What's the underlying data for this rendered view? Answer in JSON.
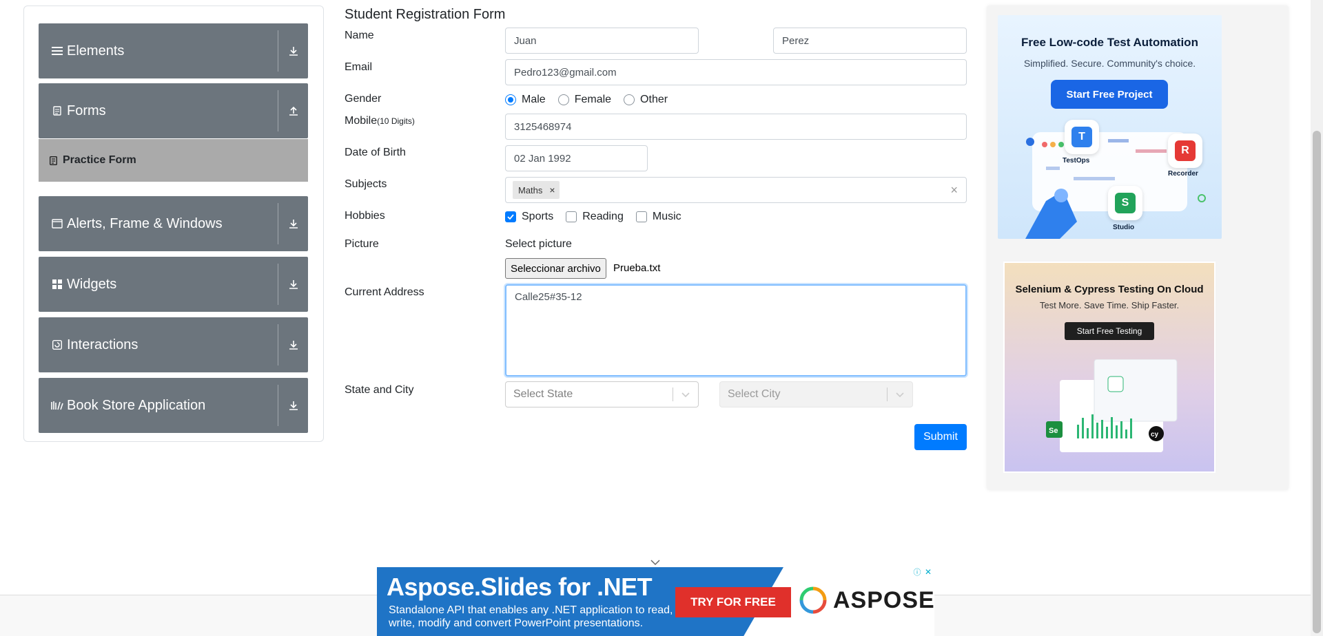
{
  "sidebar": {
    "groups": [
      {
        "label": "Elements",
        "icon": "menu-icon",
        "arrow": "download-arrow-icon"
      },
      {
        "label": "Forms",
        "icon": "document-icon",
        "arrow": "upload-arrow-icon"
      },
      {
        "label": "Alerts, Frame & Windows",
        "icon": "window-icon",
        "arrow": "download-arrow-icon"
      },
      {
        "label": "Widgets",
        "icon": "widgets-icon",
        "arrow": "download-arrow-icon"
      },
      {
        "label": "Interactions",
        "icon": "interactions-icon",
        "arrow": "download-arrow-icon"
      },
      {
        "label": "Book Store Application",
        "icon": "books-icon",
        "arrow": "download-arrow-icon"
      }
    ],
    "active_item": "Practice Form"
  },
  "form": {
    "title": "Student Registration Form",
    "labels": {
      "name": "Name",
      "email": "Email",
      "gender": "Gender",
      "mobile": "Mobile",
      "mobile_hint": "(10 Digits)",
      "dob": "Date of Birth",
      "subjects": "Subjects",
      "hobbies": "Hobbies",
      "picture": "Picture",
      "address": "Current Address",
      "state_city": "State and City"
    },
    "first_name": "Juan",
    "last_name": "Perez",
    "email": "Pedro123@gmail.com",
    "gender_options": [
      "Male",
      "Female",
      "Other"
    ],
    "gender_selected": "Male",
    "mobile": "3125468974",
    "dob": "02 Jan 1992",
    "subjects": [
      "Maths"
    ],
    "subjects_clear": "×",
    "chip_remove": "×",
    "hobbies": [
      {
        "label": "Sports",
        "checked": true
      },
      {
        "label": "Reading",
        "checked": false
      },
      {
        "label": "Music",
        "checked": false
      }
    ],
    "select_picture": "Select picture",
    "file_button": "Seleccionar archivo",
    "file_name": "Prueba.txt",
    "address": "Calle25#35-12",
    "state_placeholder": "Select State",
    "city_placeholder": "Select City",
    "submit": "Submit"
  },
  "ads": {
    "katalon": {
      "headline": "Free Low-code Test Automation",
      "sub": "Simplified. Secure. Community's choice.",
      "button": "Start Free Project",
      "apps": [
        "TestOps",
        "Recorder",
        "Studio"
      ]
    },
    "cloud": {
      "headline": "Selenium & Cypress Testing On Cloud",
      "sub": "Test More. Save Time. Ship Faster.",
      "button": "Start Free Testing"
    }
  },
  "banner": {
    "title": "Aspose.Slides for .NET",
    "text": "Standalone API that enables any .NET application to read, write, modify and convert PowerPoint presentations.",
    "cta": "TRY FOR FREE",
    "brand": "ASPOSE",
    "info": "ⓘ",
    "close": "✕"
  },
  "colors": {
    "accent": "#007bff",
    "sidebar_group": "#6c757d",
    "sidebar_active": "#aaaaaa"
  }
}
